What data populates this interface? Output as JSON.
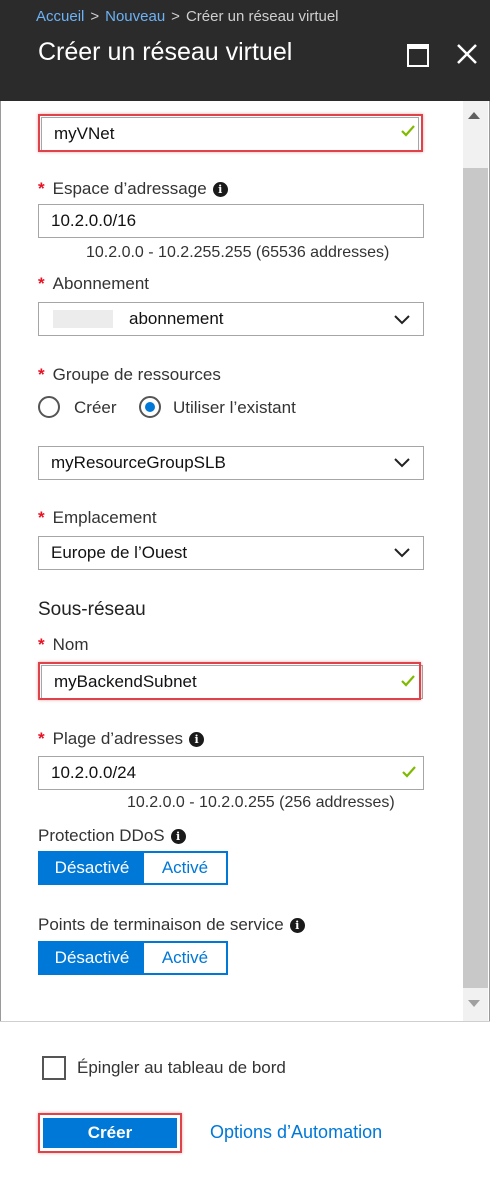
{
  "breadcrumb": {
    "items": [
      "Accueil",
      "Nouveau",
      "Créer un réseau virtuel"
    ],
    "separator": ">"
  },
  "blade": {
    "title": "Créer un réseau virtuel"
  },
  "form": {
    "name_value": "myVNet",
    "address_space": {
      "label": "Espace d’adressage",
      "value": "10.2.0.0/16",
      "hint": "10.2.0.0 - 10.2.255.255 (65536 addresses)"
    },
    "subscription": {
      "label": "Abonnement",
      "value": "abonnement"
    },
    "resource_group": {
      "label": "Groupe de ressources",
      "option_create": "Créer",
      "option_existing": "Utiliser l’existant",
      "selected": "Utiliser l’existant",
      "value": "myResourceGroupSLB"
    },
    "location": {
      "label": "Emplacement",
      "value": "Europe de l’Ouest"
    },
    "subnet": {
      "section_title": "Sous-réseau",
      "name_label": "Nom",
      "name_value": "myBackendSubnet",
      "range_label": "Plage d’adresses",
      "range_value": "10.2.0.0/24",
      "range_hint": "10.2.0.0 - 10.2.0.255 (256 addresses)"
    },
    "ddos": {
      "label": "Protection DDoS",
      "off": "Désactivé",
      "on": "Activé",
      "selected": "Désactivé"
    },
    "service_endpoints": {
      "label": "Points de terminaison de service",
      "off": "Désactivé",
      "on": "Activé",
      "selected": "Désactivé"
    },
    "required_mark": "*",
    "info_glyph": "i"
  },
  "footer": {
    "pin_label": "Épingler au tableau de bord",
    "pin_checked": false,
    "create_label": "Créer",
    "automation_label": "Options d’Automation"
  },
  "colors": {
    "accent": "#0078d7",
    "header_bg": "#2b2b2b",
    "required": "#e81123",
    "valid_check": "#7fba00",
    "highlight_box": "#e0424a"
  },
  "icons": {
    "maximize": "maximize-icon",
    "close": "close-icon",
    "info": "info-icon",
    "check": "checkmark-icon",
    "dropdown": "chevron-down-icon"
  }
}
